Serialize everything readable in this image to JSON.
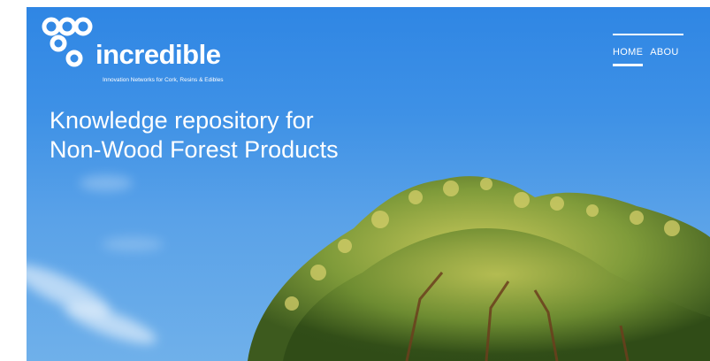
{
  "brand": {
    "name": "incredible",
    "tagline": "Innovation Networks for Cork, Resins & Edibles"
  },
  "nav": {
    "items": [
      {
        "label": "HOME",
        "active": true
      },
      {
        "label": "ABOU"
      }
    ]
  },
  "hero": {
    "headline_line1": "Knowledge repository for",
    "headline_line2": "Non-Wood Forest Products"
  },
  "colors": {
    "sky": "#3e91e6",
    "text": "#ffffff",
    "foliage": "#7e9a3a"
  }
}
